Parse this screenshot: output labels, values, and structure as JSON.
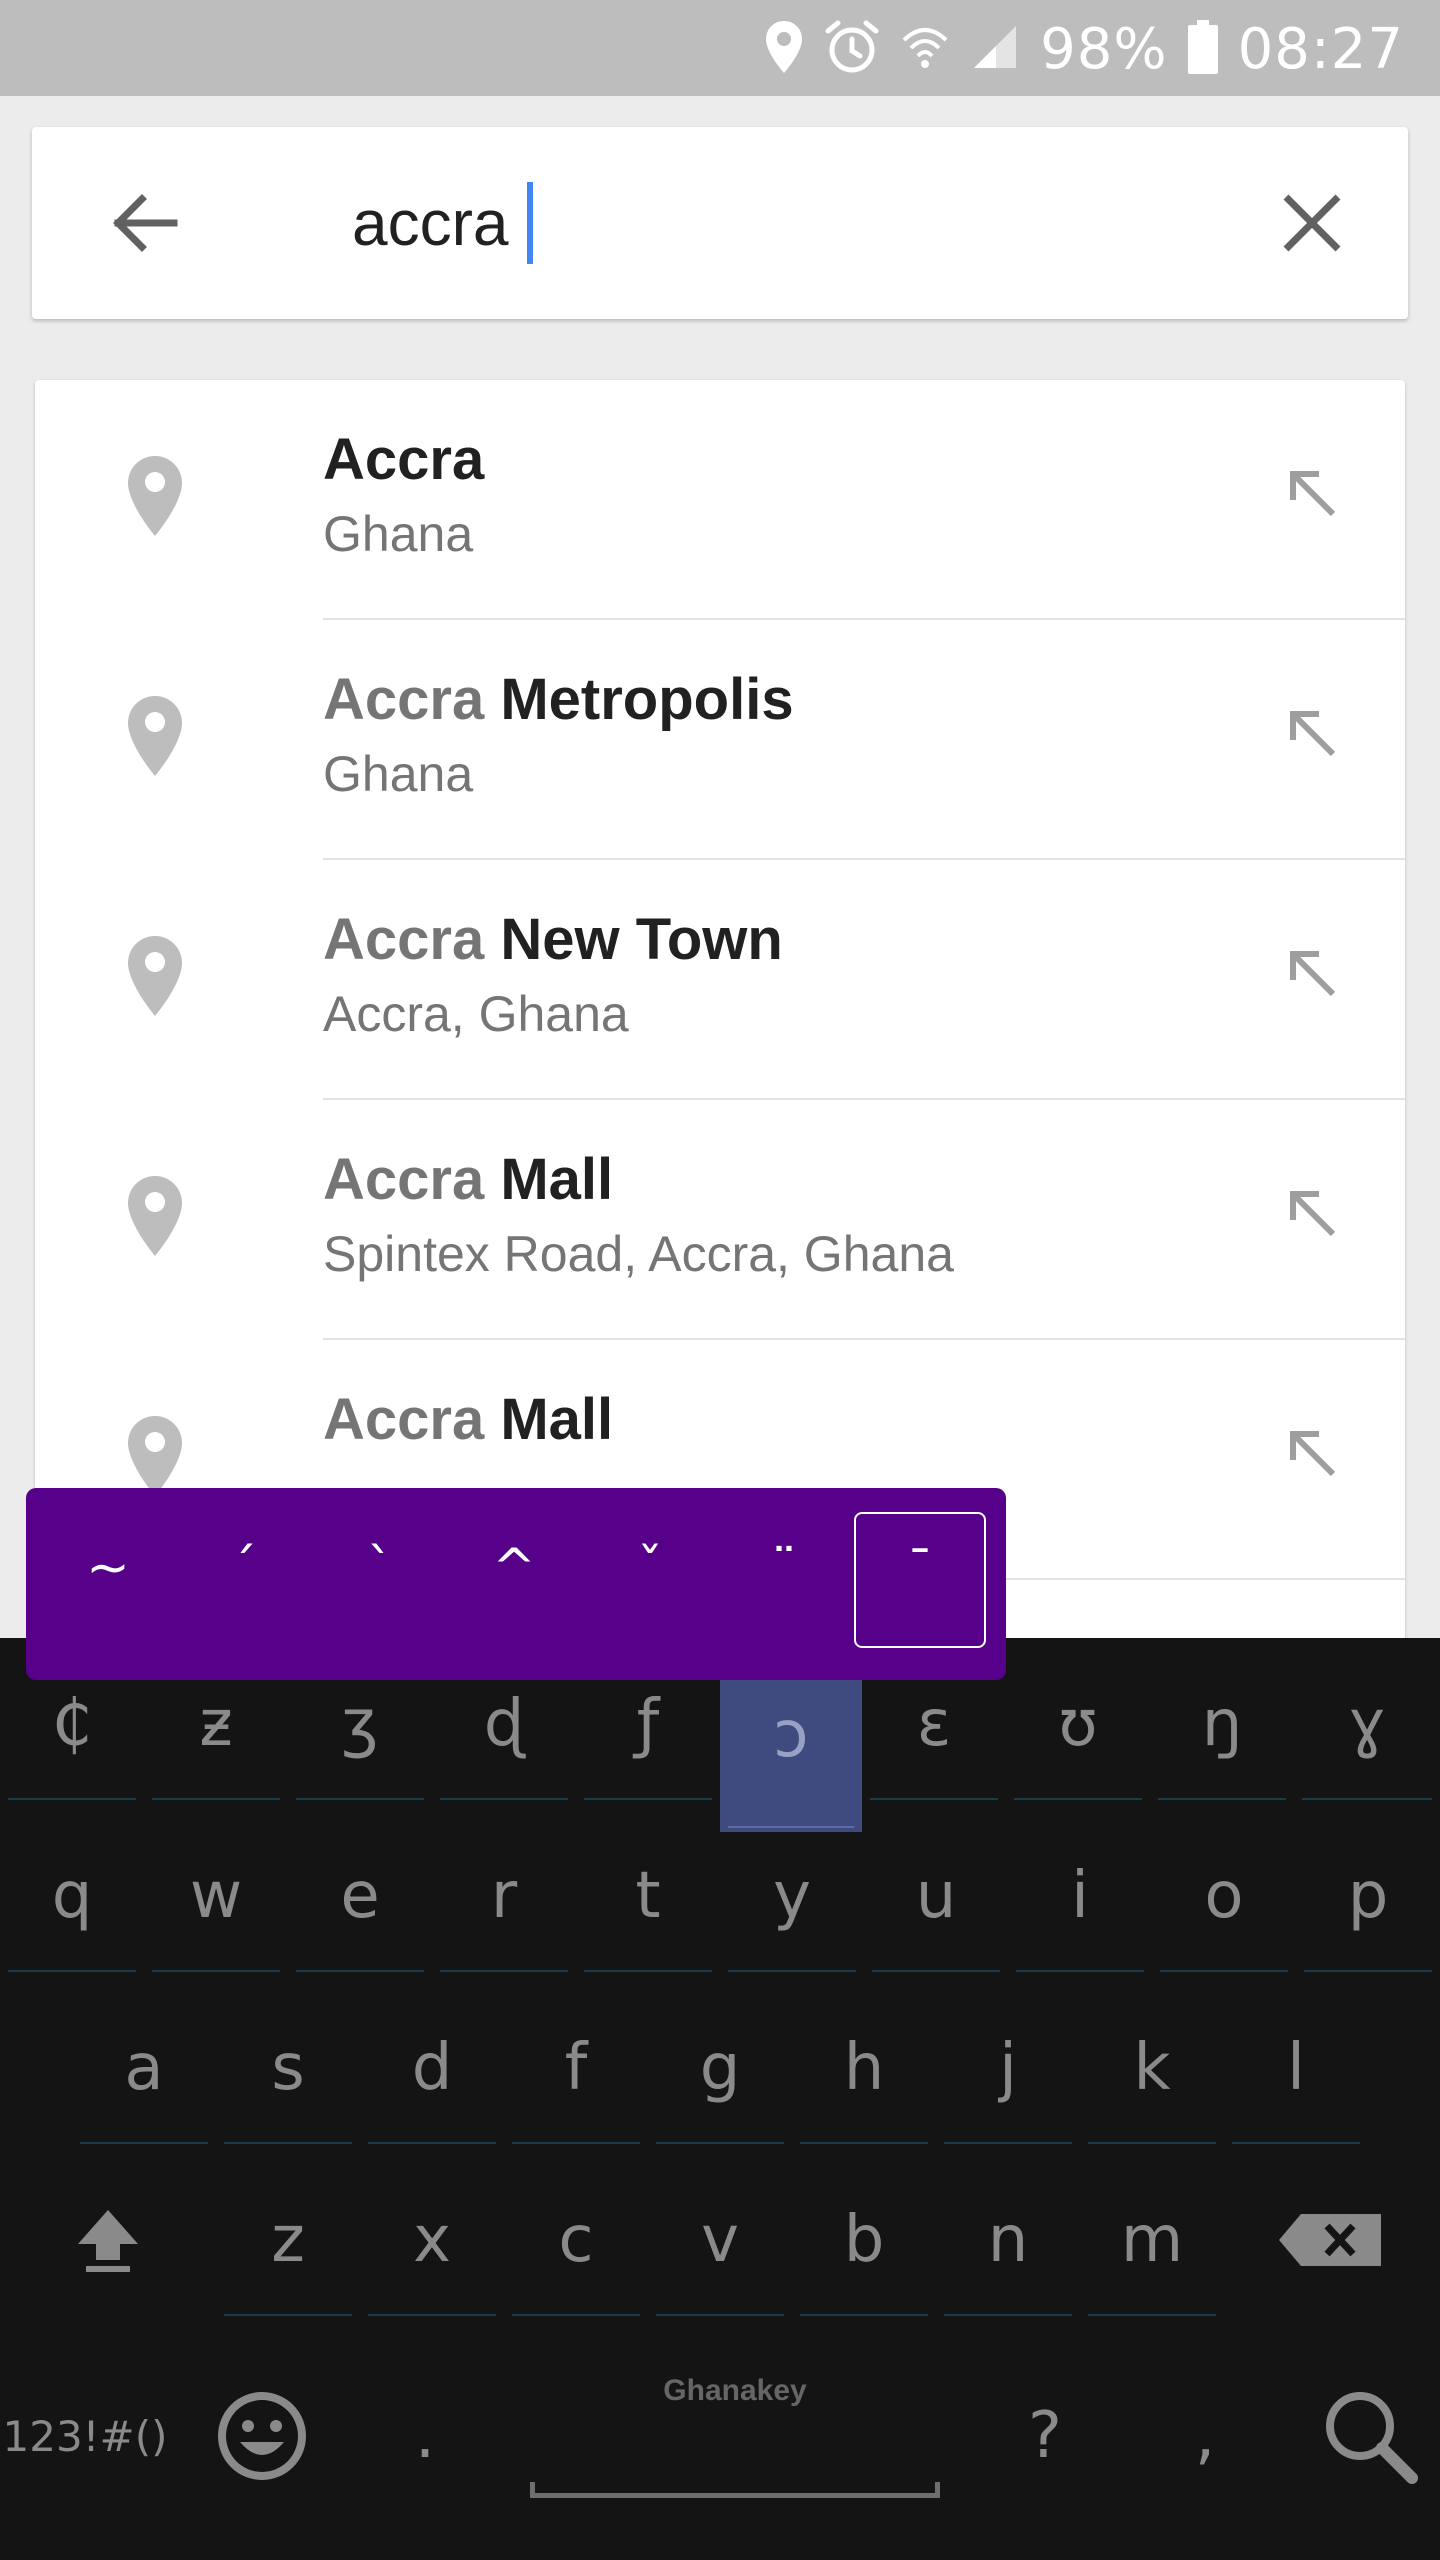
{
  "status_bar": {
    "battery_percent": "98%",
    "time": "08:27",
    "icons": [
      "location-icon",
      "alarm-icon",
      "wifi-icon",
      "signal-icon",
      "battery-icon"
    ]
  },
  "search": {
    "query": "accra",
    "back_icon": "arrow-left-icon",
    "clear_icon": "close-icon",
    "cursor_color": "#4285f4"
  },
  "results": [
    {
      "title_match": "",
      "title_rest": "Accra",
      "subtitle": "Ghana"
    },
    {
      "title_match": "Accra",
      "title_rest": " Metropolis",
      "subtitle": "Ghana"
    },
    {
      "title_match": "Accra",
      "title_rest": " New Town",
      "subtitle": "Accra, Ghana"
    },
    {
      "title_match": "Accra",
      "title_rest": " Mall",
      "subtitle": "Spintex Road, Accra, Ghana"
    },
    {
      "title_match": "Accra",
      "title_rest": " Mall",
      "subtitle": ""
    }
  ],
  "diacritics_popup": {
    "background": "#57008a",
    "keys": [
      "~",
      "´",
      "`",
      "^",
      "ˇ",
      "¨",
      "¯"
    ],
    "selected_index": 6
  },
  "keyboard": {
    "name": "Ghanakey",
    "row0": [
      "₵",
      "ƶ",
      "ʒ",
      "ɖ",
      "ƒ",
      "ɔ",
      "ɛ",
      "ʊ",
      "ŋ",
      "ɣ"
    ],
    "row0_highlighted_index": 5,
    "row1": [
      "q",
      "w",
      "e",
      "r",
      "t",
      "y",
      "u",
      "i",
      "o",
      "p"
    ],
    "row2": [
      "a",
      "s",
      "d",
      "f",
      "g",
      "h",
      "j",
      "k",
      "l"
    ],
    "row3": [
      "z",
      "x",
      "c",
      "v",
      "b",
      "n",
      "m"
    ],
    "symbols_label": "123!#()",
    "period": ".",
    "question": "?",
    "comma": ",",
    "icons": [
      "shift-icon",
      "backspace-icon",
      "emoji-icon",
      "search-icon"
    ]
  }
}
